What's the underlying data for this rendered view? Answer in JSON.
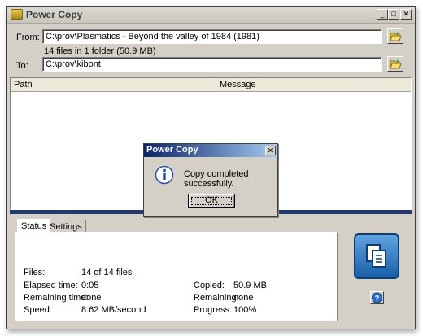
{
  "window": {
    "title": "Power Copy"
  },
  "form": {
    "from_label": "From:",
    "from_value": "C:\\prov\\Plasmatics - Beyond the valley of 1984 (1981)",
    "summary": "14 files in 1 folder (50.9 MB)",
    "to_label": "To:",
    "to_value": "C:\\prov\\kibont"
  },
  "list": {
    "columns": [
      "Path",
      "Message"
    ]
  },
  "tabs": [
    "Status",
    "Settings"
  ],
  "status": {
    "files_label": "Files:",
    "files_value": "14 of 14 files",
    "elapsed_label": "Elapsed time:",
    "elapsed_value": "0:05",
    "remaining_time_label": "Remaining time:",
    "remaining_time_value": "done",
    "speed_label": "Speed:",
    "speed_value": "8.62 MB/second",
    "copied_label": "Copied:",
    "copied_value": "50.9 MB",
    "remaining_label": "Remaining:",
    "remaining_value": "none",
    "progress_label": "Progress:",
    "progress_value": "100%"
  },
  "dialog": {
    "title": "Power Copy",
    "message": "Copy completed successfully.",
    "ok_label": "OK",
    "close_glyph": "✕"
  },
  "titlebar_buttons": {
    "minimize": "_",
    "maximize": "□",
    "close": "✕"
  },
  "help_glyph": "?",
  "icons": {
    "app": "app-icon",
    "folder": "folder-open-icon",
    "info": "info-icon",
    "copy": "copy-files-icon",
    "help": "help-icon"
  },
  "colors": {
    "accent_bar": "#22386e",
    "dialog_title": "#0a246a",
    "copy_button": "#1a5fa8"
  }
}
